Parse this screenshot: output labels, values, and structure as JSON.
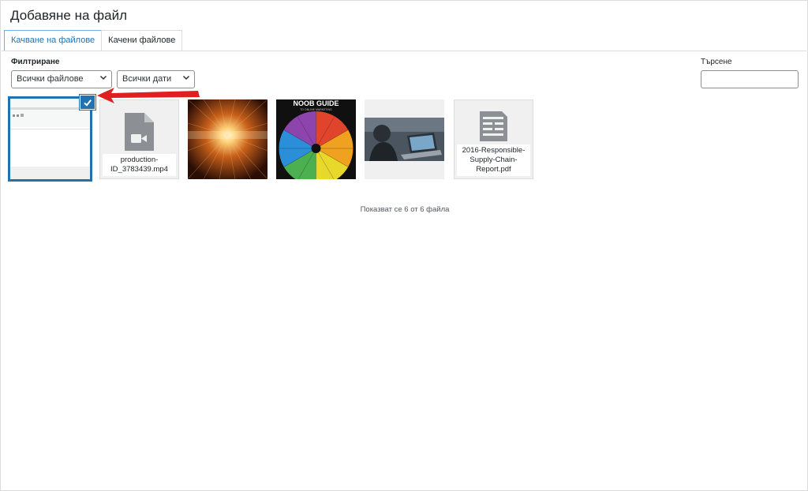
{
  "header": {
    "title": "Добавяне на файл"
  },
  "tabs": [
    {
      "label": "Качване на файлове",
      "active": true
    },
    {
      "label": "Качени файлове",
      "active": false
    }
  ],
  "filters": {
    "label": "Филтриране",
    "type_select": "Всички файлове",
    "date_select": "Всички дати"
  },
  "search": {
    "label": "Търсене",
    "value": ""
  },
  "attachments": [
    {
      "kind": "screenshot-image",
      "name": "",
      "selected": true
    },
    {
      "kind": "video-icon",
      "name": "production-ID_3783439.mp4",
      "selected": false
    },
    {
      "kind": "image-light-tunnel",
      "name": "",
      "selected": false
    },
    {
      "kind": "image-color-wheel",
      "name": "",
      "selected": false,
      "visible_text": [
        "NOOB GUIDE",
        "TO ONLINE MARKETING"
      ]
    },
    {
      "kind": "image-person-laptop",
      "name": "",
      "selected": false
    },
    {
      "kind": "document-icon",
      "name": "2016-Responsible-Supply-Chain-Report.pdf",
      "selected": false
    }
  ],
  "status": {
    "text": "Показват се 6 от 6 файла"
  },
  "colors": {
    "accent": "#2271b1",
    "arrow": "#e02020"
  }
}
